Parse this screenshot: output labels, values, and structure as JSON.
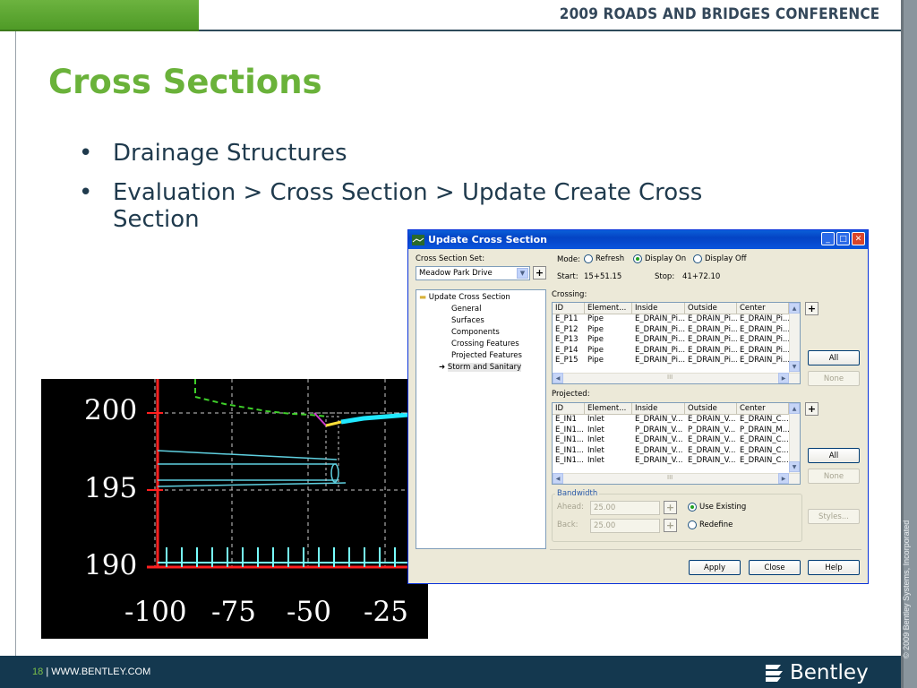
{
  "header": {
    "conference": "2009 ROADS AND BRIDGES CONFERENCE"
  },
  "slide": {
    "title": "Cross Sections",
    "bullets": [
      "Drainage Structures",
      "Evaluation > Cross Section > Update Create Cross Section"
    ]
  },
  "footer": {
    "page_number": "18",
    "separator": "|",
    "website": "WWW.BENTLEY.COM",
    "brand": "Bentley",
    "copyright": "© 2009 Bentley Systems, Incorporated"
  },
  "chart": {
    "y_labels": [
      "200",
      "195",
      "190"
    ],
    "x_labels": [
      "-100",
      "-75",
      "-50",
      "-25"
    ]
  },
  "dialog": {
    "title": "Update Cross Section",
    "cross_section_set_label": "Cross Section Set:",
    "cross_section_set_value": "Meadow Park Drive",
    "mode_label": "Mode:",
    "mode_options": [
      "Refresh",
      "Display On",
      "Display Off"
    ],
    "mode_selected": "Display On",
    "start_label": "Start:",
    "start_value": "15+51.15",
    "stop_label": "Stop:",
    "stop_value": "41+72.10",
    "tree": {
      "root": "Update Cross Section",
      "children": [
        "General",
        "Surfaces",
        "Components",
        "Crossing Features",
        "Projected Features",
        "Storm and Sanitary"
      ]
    },
    "crossing": {
      "label": "Crossing:",
      "columns": [
        "ID",
        "Element...",
        "Inside",
        "Outside",
        "Center"
      ],
      "rows": [
        [
          "E_P11",
          "Pipe",
          "E_DRAIN_Pi...",
          "E_DRAIN_Pi...",
          "E_DRAIN_Pi..."
        ],
        [
          "E_P12",
          "Pipe",
          "E_DRAIN_Pi...",
          "E_DRAIN_Pi...",
          "E_DRAIN_Pi..."
        ],
        [
          "E_P13",
          "Pipe",
          "E_DRAIN_Pi...",
          "E_DRAIN_Pi...",
          "E_DRAIN_Pi..."
        ],
        [
          "E_P14",
          "Pipe",
          "E_DRAIN_Pi...",
          "E_DRAIN_Pi...",
          "E_DRAIN_Pi..."
        ],
        [
          "E_P15",
          "Pipe",
          "E_DRAIN_Pi...",
          "E_DRAIN_Pi...",
          "E_DRAIN_Pi..."
        ]
      ],
      "scroll_middle": "III"
    },
    "projected": {
      "label": "Projected:",
      "columns": [
        "ID",
        "Element...",
        "Inside",
        "Outside",
        "Center"
      ],
      "rows": [
        [
          "E_IN1",
          "Inlet",
          "E_DRAIN_V...",
          "E_DRAIN_V...",
          "E_DRAIN_C..."
        ],
        [
          "E_IN1...",
          "Inlet",
          "P_DRAIN_V...",
          "P_DRAIN_V...",
          "P_DRAIN_M..."
        ],
        [
          "E_IN1...",
          "Inlet",
          "E_DRAIN_V...",
          "E_DRAIN_V...",
          "E_DRAIN_C..."
        ],
        [
          "E_IN1...",
          "Inlet",
          "E_DRAIN_V...",
          "E_DRAIN_V...",
          "E_DRAIN_C..."
        ],
        [
          "E_IN1...",
          "Inlet",
          "E_DRAIN_V...",
          "E_DRAIN_V...",
          "E_DRAIN_C..."
        ]
      ],
      "scroll_middle": "III"
    },
    "bandwidth": {
      "label": "Bandwidth",
      "ahead_label": "Ahead:",
      "ahead_value": "25.00",
      "back_label": "Back:",
      "back_value": "25.00",
      "options": [
        "Use Existing",
        "Redefine"
      ],
      "selected": "Use Existing"
    },
    "buttons": {
      "add": "+",
      "all": "All",
      "none": "None",
      "styles": "Styles...",
      "apply": "Apply",
      "close": "Close",
      "help": "Help"
    }
  }
}
